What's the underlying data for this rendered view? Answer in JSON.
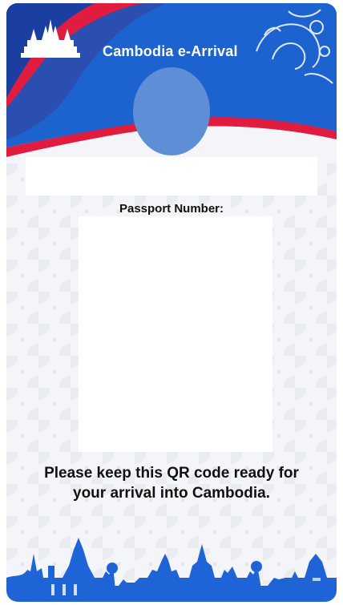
{
  "header": {
    "title": "Cambodia e-Arrival",
    "emblem_icon": "angkor-wat-icon",
    "ornament_icon": "khmer-ornament-icon"
  },
  "profile": {
    "avatar_icon": "avatar-photo"
  },
  "passport": {
    "label": "Passport Number:"
  },
  "qr": {
    "icon": "qr-code"
  },
  "message": {
    "line1": "Please keep this QR code ready for",
    "line2": "your arrival into Cambodia."
  },
  "footer": {
    "skyline_icon": "cambodia-skyline-icon"
  },
  "colors": {
    "header_blue": "#1d63cf",
    "header_dark_blue": "#1a3fa0",
    "header_red": "#e11d3f",
    "avatar": "#5e8fd6",
    "footer_blue": "#1e64d6",
    "text": "#111111"
  }
}
